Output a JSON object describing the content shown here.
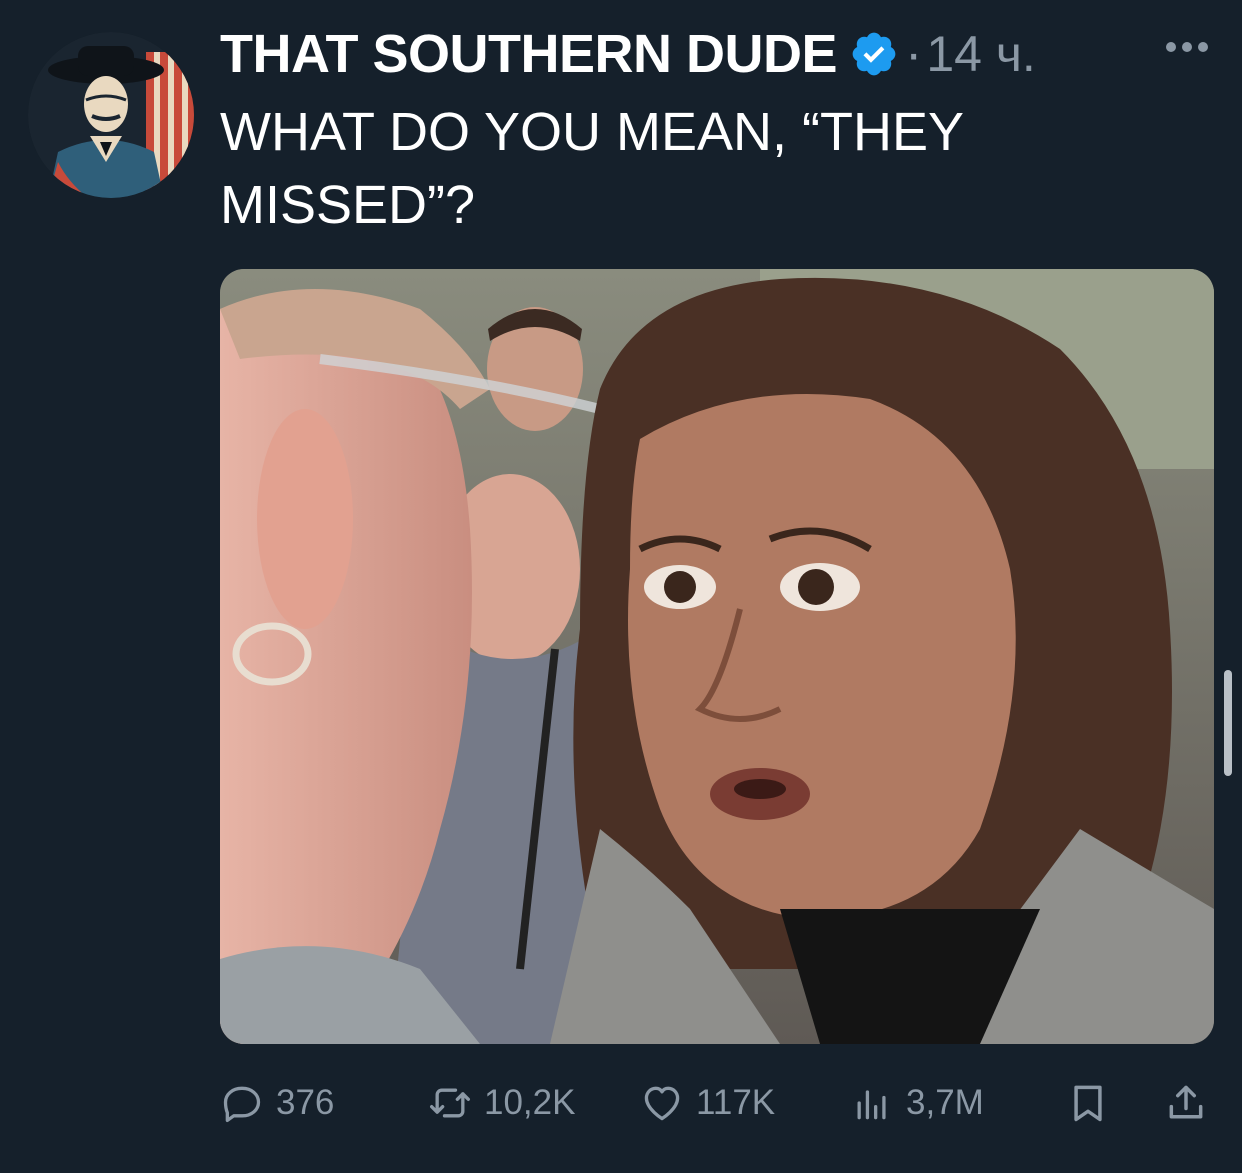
{
  "tweet": {
    "author_name": "THAT SOUTHERN DUDE",
    "separator": "·",
    "timestamp": "14 ч.",
    "text": "WHAT DO YOU MEAN, “THEY MISSED”?",
    "verified": true,
    "avatar_icon": "cowboy-portrait",
    "more_icon": "ellipsis-icon",
    "media_description_icon": "photo"
  },
  "actions": {
    "replies": {
      "icon": "reply-bubble-icon",
      "count": "376"
    },
    "retweets": {
      "icon": "retweet-icon",
      "count": "10,2K"
    },
    "likes": {
      "icon": "heart-icon",
      "count": "117K"
    },
    "views": {
      "icon": "views-chart-icon",
      "count": "3,7M"
    },
    "bookmark": {
      "icon": "bookmark-icon"
    },
    "share": {
      "icon": "share-icon"
    }
  },
  "colors": {
    "background": "#15202b",
    "text_primary": "#ffffff",
    "text_secondary": "#8b98a5",
    "verified_badge": "#1d9bf0"
  }
}
